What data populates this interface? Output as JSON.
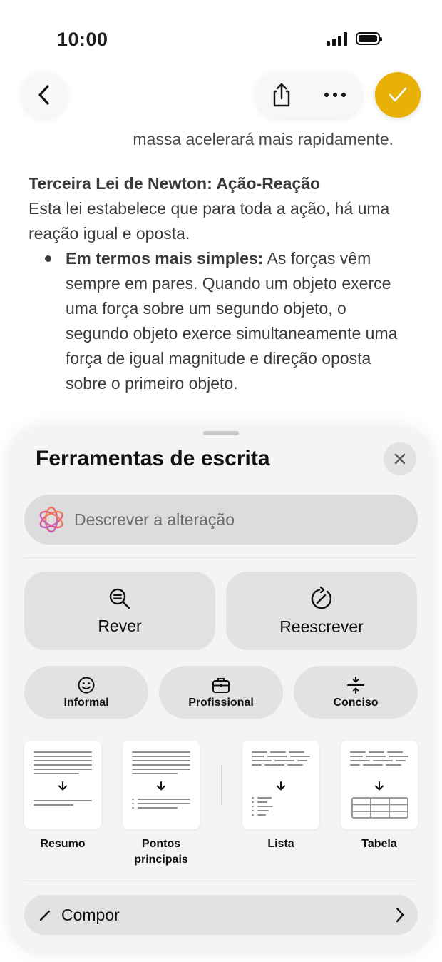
{
  "status_bar": {
    "time": "10:00"
  },
  "note": {
    "prev_line": "massa acelerará mais rapidamente.",
    "heading": "Terceira Lei de Newton: Ação-Reação",
    "paragraph": "Esta lei estabelece que para toda a ação, há uma reação igual e oposta.",
    "bullet_bold": "Em termos mais simples:",
    "bullet_text": " As forças vêm sempre em pares. Quando um objeto exerce uma força sobre um segundo objeto, o segundo objeto exerce simultaneamente uma força de igual magnitude e direção oposta sobre o primeiro objeto."
  },
  "writing_tools": {
    "title": "Ferramentas de escrita",
    "describe_placeholder": "Descrever a alteração",
    "review_label": "Rever",
    "rewrite_label": "Reescrever",
    "tones": [
      {
        "label": "Informal",
        "icon": "smiley-icon"
      },
      {
        "label": "Profissional",
        "icon": "briefcase-icon"
      },
      {
        "label": "Conciso",
        "icon": "condense-icon"
      }
    ],
    "formats": [
      {
        "label": "Resumo",
        "icon": "summary-doc-icon"
      },
      {
        "label": "Pontos principais",
        "icon": "key-points-doc-icon"
      },
      {
        "label": "Lista",
        "icon": "list-doc-icon"
      },
      {
        "label": "Tabela",
        "icon": "table-doc-icon"
      }
    ],
    "compose_label": "Compor"
  },
  "colors": {
    "accent": "#e8b106",
    "sheet": "#f4f4f4",
    "button": "#e2e2e2"
  }
}
